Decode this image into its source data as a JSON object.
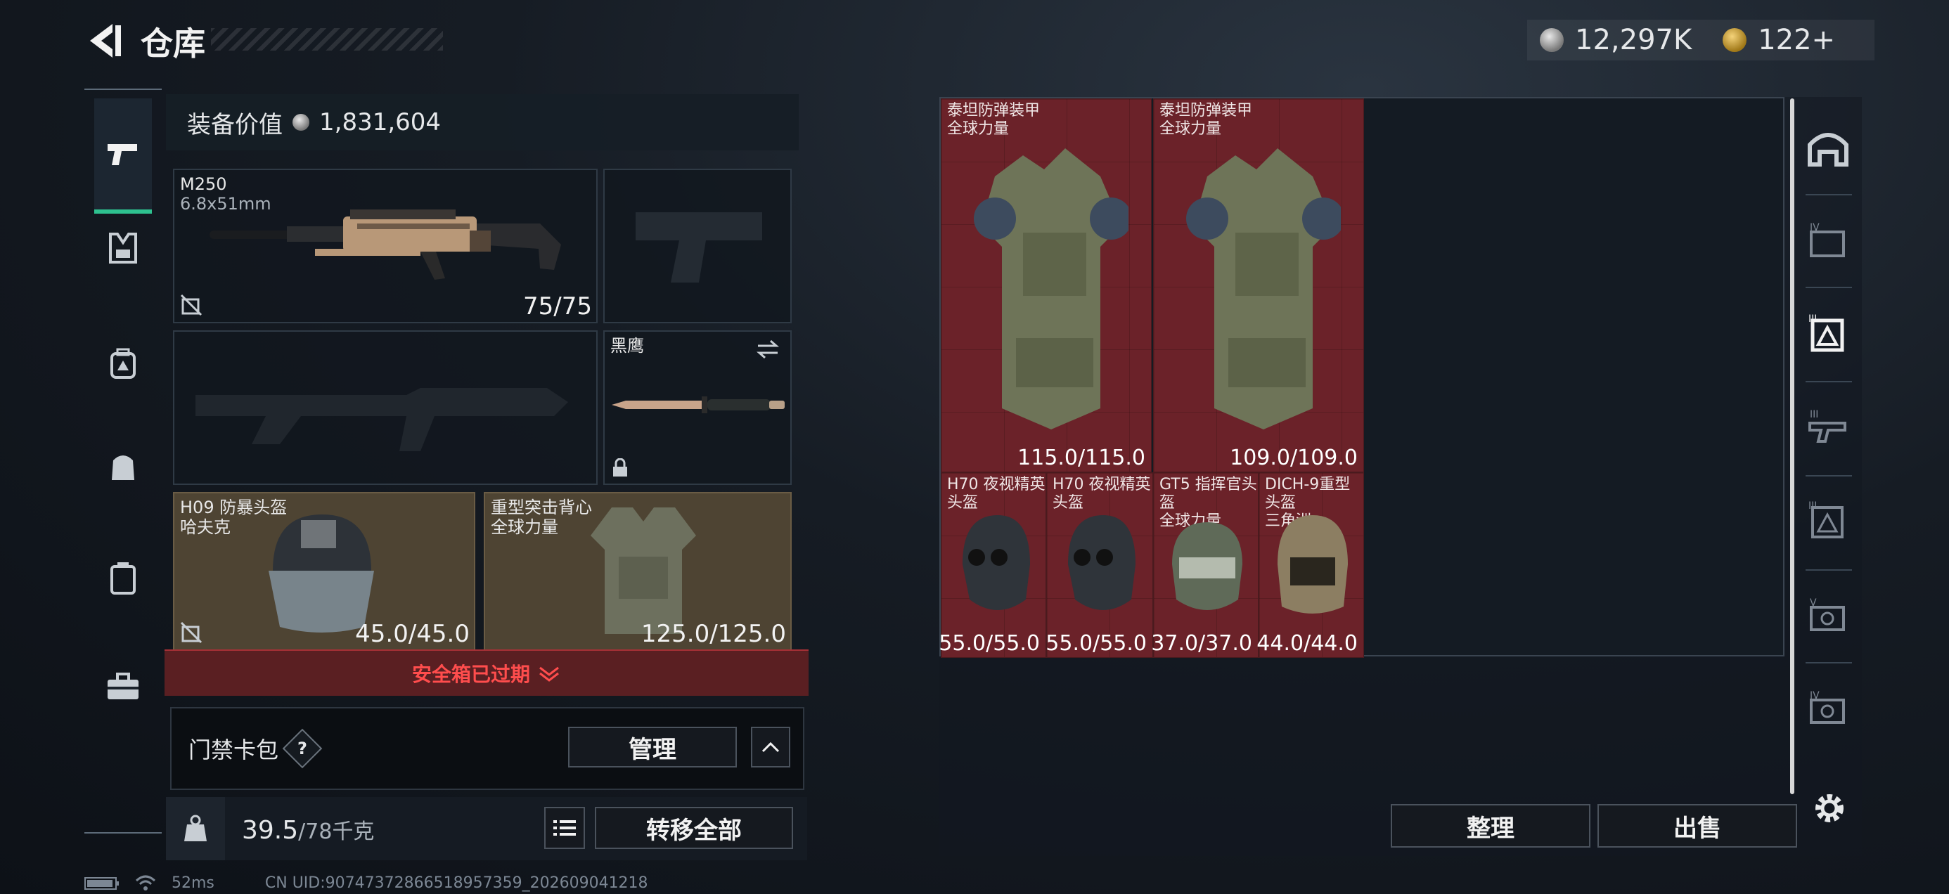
{
  "header": {
    "title": "仓库",
    "silver": "12,297K",
    "gold": "122+"
  },
  "left_nav": [
    "pistol-icon",
    "vest-icon",
    "backpack-icon",
    "chest-rig-icon",
    "case-icon",
    "toolbox-icon"
  ],
  "equipment": {
    "value_label": "装备价值",
    "value": "1,831,604",
    "primary": {
      "name": "M250",
      "ammo": "6.8x51mm",
      "durability": "75/75"
    },
    "knife": {
      "name": "黑鹰"
    },
    "helmet": {
      "name": "H09 防暴头盔",
      "maker": "哈夫克",
      "durability": "45.0/45.0"
    },
    "armor": {
      "name": "重型突击背心",
      "maker": "全球力量",
      "durability": "125.0/125.0"
    }
  },
  "safebox": {
    "status": "安全箱已过期"
  },
  "card_pack": {
    "label": "门禁卡包",
    "help": "?",
    "manage": "管理"
  },
  "capacity": {
    "current": "39.5",
    "max": "/78千克",
    "transfer_all": "转移全部"
  },
  "stash": {
    "items": [
      {
        "name": "泰坦防弹装甲",
        "maker": "全球力量",
        "durability": "115.0/115.0"
      },
      {
        "name": "泰坦防弹装甲",
        "maker": "全球力量",
        "durability": "109.0/109.0"
      },
      {
        "name": "H70 夜视精英头盔",
        "maker": "",
        "durability": "55.0/55.0"
      },
      {
        "name": "H70 夜视精英头盔",
        "maker": "",
        "durability": "55.0/55.0"
      },
      {
        "name": "GT5 指挥官头盔",
        "maker": "全球力量",
        "durability": "37.0/37.0"
      },
      {
        "name": "DICH-9重型头盔",
        "maker": "三角洲",
        "durability": "44.0/44.0"
      }
    ],
    "sort": "整理",
    "sell": "出售"
  },
  "right_nav": [
    "stash-main-icon",
    "tier-iv-folder-icon",
    "tier-iii-armor-icon",
    "tier-iii-gun-icon",
    "tier-ii-armor-icon",
    "tier-v-case-icon",
    "tier-iv-case-icon",
    "settings-icon"
  ],
  "status": {
    "ping": "52ms",
    "uid": "CN UID:9074737286651895735​9_202609041218"
  }
}
